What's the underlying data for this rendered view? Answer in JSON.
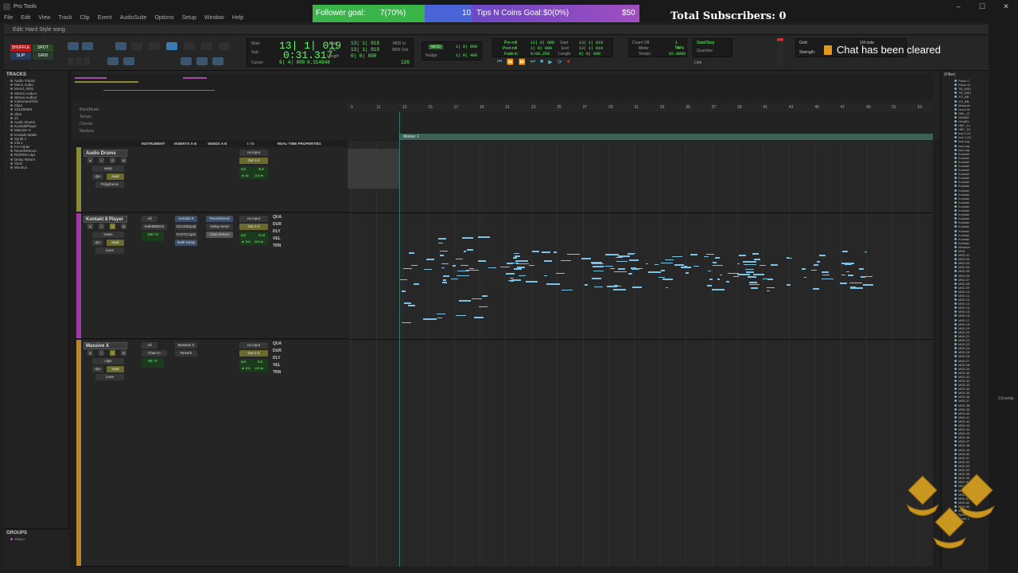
{
  "os": {
    "title": "Pro Tools",
    "controls": [
      "–",
      "☐",
      "✕"
    ]
  },
  "menu": [
    "File",
    "Edit",
    "View",
    "Track",
    "Clip",
    "Event",
    "AudioSuite",
    "Options",
    "Setup",
    "Window",
    "Help"
  ],
  "overlay": {
    "follower_label": "Follower goal:",
    "follower_value": "7(70%)",
    "follower_target": "10",
    "tips_label": "Tips N Coins Goal:",
    "tips_value": "$0(0%)",
    "tips_target": "$50",
    "total_subscribers": "Total Subscribers: 0",
    "chat_cleared": "Chat has been cleared"
  },
  "edit_window": {
    "title": "Edit: Hard Style song"
  },
  "toolbar": {
    "modes": [
      "SHUFFLE",
      "SPOT",
      "SLIP",
      "GRID"
    ],
    "counter": {
      "main_label": "Main",
      "sub_label": "Sub",
      "main_value": "13| 1| 019",
      "sub_value": "0:31.317",
      "cursor_label": "Cursor",
      "cursor_value": "9| 4| 000",
      "sample_value": "0.314848",
      "start_label": "Start",
      "end_label": "End",
      "length_label": "Length",
      "start_value": "13| 1| 019",
      "end_value": "13| 1| 019",
      "length_value": "0| 0| 000",
      "midi_in": "MIDI In",
      "midi_out": "MIDI Out",
      "tempo_value": "120"
    },
    "nudge": {
      "label": "Nudge",
      "grid_value": "1| 0| 000",
      "nudge_value": "1| 0| 480"
    },
    "pre_post": {
      "preroll": "Pre-roll",
      "postroll": "Post-roll",
      "fadein": "Fade-in",
      "pre_value": "12| 0| 000",
      "post_value": "1| 0| 000",
      "fade_value": "0:00.250",
      "start_value": "13| 1| 019",
      "end_value": "13| 1| 019",
      "length_value": "0| 0| 000"
    },
    "meter": {
      "count_off": "Count Off",
      "meter": "Meter",
      "tempo": "Tempo",
      "bars": "1 bar",
      "sig": "4/4",
      "tempo_val": "92.0000"
    },
    "quantize": {
      "start_stop": "Start/Stop",
      "quantize": "Quantize",
      "link": "Link"
    },
    "grid": {
      "grid_label": "Grid:",
      "strength_label": "Strength:",
      "grid_value": "1/4 note"
    }
  },
  "tracks_panel": {
    "header": "TRACKS",
    "items": [
      "Audio Tracks",
      "Mono Audio",
      "MnAd_0001",
      "Stereo Audio1",
      "Stereo Audio2",
      "InstrumentTrks",
      "Clips",
      "S21280901",
      "clips",
      "s3",
      "Audio Drums",
      "KontaktPlayer",
      "Massive X",
      "Kontakt Matlin",
      "Synth 1",
      "Inst 1",
      "FX Folder",
      "ReverbReturn",
      "RvrbRtrn.dp1",
      "Delay Return",
      "Click",
      "Mix Bus"
    ]
  },
  "groups_panel": {
    "header": "GROUPS",
    "item": "<ALL>"
  },
  "ruler": {
    "rows": [
      "Bars|Beats",
      "Tempo",
      "Chords",
      "Markers"
    ],
    "bars": [
      "9",
      "11",
      "13",
      "15",
      "17",
      "19",
      "21",
      "23",
      "25",
      "27",
      "29",
      "31",
      "33",
      "35",
      "37",
      "39",
      "41",
      "43",
      "45",
      "47",
      "49",
      "51",
      "53"
    ],
    "marker": "Marker 1"
  },
  "columns": {
    "instrument": "INSTRUMENT",
    "inserts": "INSERTS A-E",
    "sends": "SENDS A-E",
    "io": "I / O",
    "realtime": "REAL-TIME PROPERTIES"
  },
  "track_rows": [
    {
      "name": "Audio Drums",
      "color": "#8a8a3a",
      "mode": "warp",
      "dyn": "dyn",
      "read": "read",
      "poly": "Polyphonic",
      "io_in": "no input",
      "io_out": "Out 1-2",
      "vol": "vol",
      "vol_value": "-6.6",
      "pan": "◄ 49",
      "pan_r": "100 ►",
      "realtime": []
    },
    {
      "name": "Kontakt 8 Player",
      "color": "#a43aa8",
      "mode": "notes",
      "read": "none",
      "instrument": "All",
      "instrument_sub": "Kntkt8MIDI1",
      "inserts": [
        "Kontakt 8",
        "Ozn10Equal",
        "FASTCmprs",
        "Multi-Delay"
      ],
      "sends": [
        "ReverbSend",
        "Delay Send",
        "Chan Return"
      ],
      "io_in": "no input",
      "io_out": "Out 1-2",
      "vol": "vol",
      "vol_value": "+1.8",
      "pan": "◄ 100",
      "pan_r": "100 ►",
      "inst_vol": "100",
      "inst_pan": "0",
      "realtime": [
        "QUA",
        "DUR",
        "DLY",
        "VEL",
        "TRN"
      ]
    },
    {
      "name": "Massive X",
      "color": "#b8862f",
      "mode": "clips",
      "dyn": "dyn",
      "read": "read",
      "none": "none",
      "instrument": "All",
      "instrument_sub": "Chan In",
      "inserts": [
        "Massive X",
        "Reverb"
      ],
      "io_in": "no input",
      "io_out": "Out 1-2",
      "vol": "vol",
      "vol_value": "0.0",
      "pan": "◄ 100",
      "pan_r": "100 ►",
      "inst_vol": "90",
      "inst_pan": "0",
      "realtime": [
        "QUA",
        "DUR",
        "DLY",
        "VEL",
        "TRN"
      ]
    }
  ],
  "right_bin": {
    "filter": "(Filter)",
    "items": [
      "Piano C",
      "Piano Dr",
      "TB_MIDI",
      "TB_MIDI",
      "XO_BB",
      "XO_BB",
      "Massive",
      "Drum M",
      "DBL_12",
      "GhstB2",
      "GhstB1",
      "HBT_14",
      "HBT_15",
      "Inst 1-02",
      "Inst 1-03",
      "IsoLoop",
      "IsoLoop",
      "IsoLoop",
      "Kontakt",
      "Kontakt",
      "Kontakt",
      "Kontakt",
      "Kontakt",
      "Kontakt",
      "Kontakt",
      "Kontakt",
      "Kontakt",
      "Kontakt",
      "Kontakt",
      "Kontakt",
      "Kontakt",
      "Kontakt",
      "Kontakt",
      "Kontakt",
      "Kontakt",
      "Kontakt",
      "Kontakt",
      "Kontakt",
      "Kontakt",
      "Kontakt",
      "Kontakt",
      "Massive",
      "MIDI",
      "MIDI-01",
      "MIDI-02",
      "MIDI-03",
      "MIDI-04",
      "MIDI-05",
      "MIDI-06",
      "MIDI-07",
      "MIDI-08",
      "MIDI-09",
      "MIDI-10",
      "MIDI-11",
      "MIDI-12",
      "MIDI-13",
      "MIDI-14",
      "MIDI-15",
      "MIDI-16",
      "MIDI-17",
      "MIDI-18",
      "MIDI-19",
      "MIDI-20",
      "MIDI-21",
      "MIDI-22",
      "MIDI-23",
      "MIDI-24",
      "MIDI-25",
      "MIDI-26",
      "MIDI-27",
      "MIDI-28",
      "MIDI-29",
      "MIDI-30",
      "MIDI-31",
      "MIDI-32",
      "MIDI-33",
      "MIDI-34",
      "MIDI-35",
      "MIDI-36",
      "MIDI-37",
      "MIDI-38",
      "MIDI-39",
      "MIDI-40",
      "MIDI-41",
      "MIDI-42",
      "MIDI-43",
      "MIDI-44",
      "MIDI-45",
      "MIDI-46",
      "MIDI-47",
      "MIDI-48",
      "MIDI-49",
      "MIDI-50",
      "MIDI-51",
      "MIDI-52",
      "MIDI-53",
      "MIDI-54",
      "MIDI-55",
      "MIDI-56",
      "MIDI-57",
      "MIDI-58",
      "MIDI-59",
      "MIDI-60",
      "MIDI-61",
      "MIDI-62",
      "MIDI-63",
      "MIDI-64",
      "Synth 1",
      "Synth 1"
    ]
  },
  "side_strip": {
    "events": "0 Events"
  },
  "colors": {
    "accent_green": "#5dff63",
    "midi_note": "#7dc3e8",
    "marker": "#3d6358"
  }
}
